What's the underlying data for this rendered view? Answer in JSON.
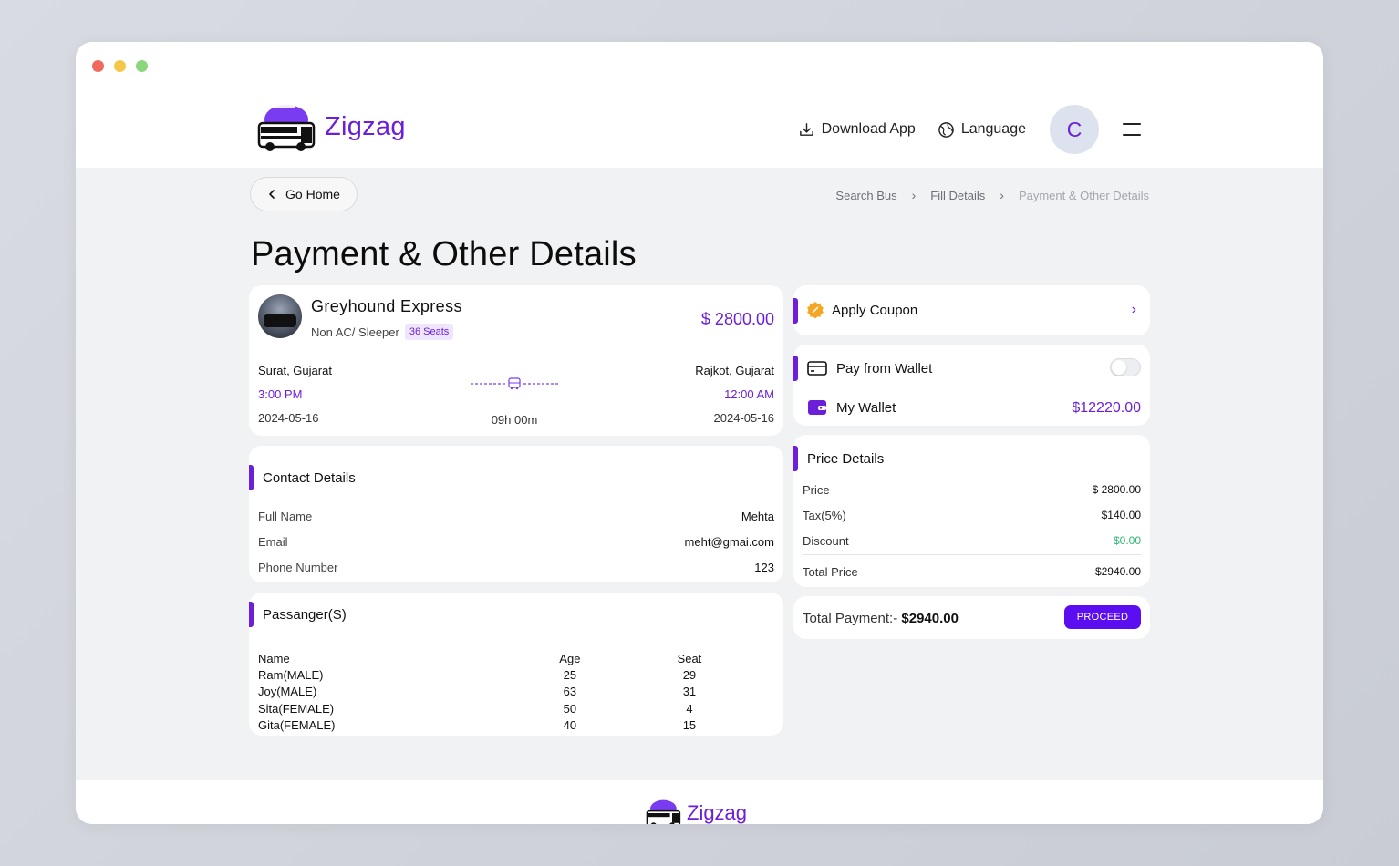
{
  "brand": {
    "name": "Zigzag",
    "color": "#6b1fd8"
  },
  "header": {
    "download_app": "Download App",
    "language": "Language",
    "avatar_initial": "C"
  },
  "nav": {
    "go_home": "Go Home",
    "breadcrumb": [
      "Search Bus",
      "Fill Details",
      "Payment & Other Details"
    ]
  },
  "page": {
    "title": "Payment & Other Details"
  },
  "bus": {
    "name": "Greyhound Express",
    "type": "Non AC/ Sleeper",
    "seats": "36 Seats",
    "price": "$ 2800.00",
    "from": {
      "city": "Surat, Gujarat",
      "time": "3:00 PM",
      "date": "2024-05-16"
    },
    "to": {
      "city": "Rajkot, Gujarat",
      "time": "12:00 AM",
      "date": "2024-05-16"
    },
    "duration": "09h 00m"
  },
  "contact": {
    "title": "Contact Details",
    "rows": [
      {
        "label": "Full Name",
        "value": "Mehta"
      },
      {
        "label": "Email",
        "value": "meht@gmai.com"
      },
      {
        "label": "Phone Number",
        "value": "123"
      }
    ]
  },
  "passengers": {
    "title": "Passanger(S)",
    "columns": [
      "Name",
      "Age",
      "Seat"
    ],
    "rows": [
      [
        "Ram(MALE)",
        "25",
        "29"
      ],
      [
        "Joy(MALE)",
        "63",
        "31"
      ],
      [
        "Sita(FEMALE)",
        "50",
        "4"
      ],
      [
        "Gita(FEMALE)",
        "40",
        "15"
      ]
    ]
  },
  "coupon": {
    "label": "Apply Coupon"
  },
  "wallet": {
    "pay_label": "Pay from Wallet",
    "toggle_on": false,
    "my_wallet": "My Wallet",
    "balance": "$12220.00"
  },
  "price_details": {
    "title": "Price Details",
    "rows": [
      {
        "label": "Price",
        "value": "$ 2800.00"
      },
      {
        "label": "Tax(5%)",
        "value": "$140.00"
      },
      {
        "label": "Discount",
        "value": "$0.00"
      },
      {
        "label": "Total Price",
        "value": "$2940.00"
      }
    ]
  },
  "total": {
    "label": "Total Payment:-",
    "amount": "$2940.00",
    "proceed": "PROCEED"
  },
  "icons": {
    "download": "download-icon",
    "language": "globe-icon",
    "menu": "hamburger-icon",
    "back": "chevron-left-icon",
    "coupon": "coupon-badge-icon",
    "card": "credit-card-icon",
    "wallet": "wallet-icon",
    "bus": "bus-icon"
  }
}
